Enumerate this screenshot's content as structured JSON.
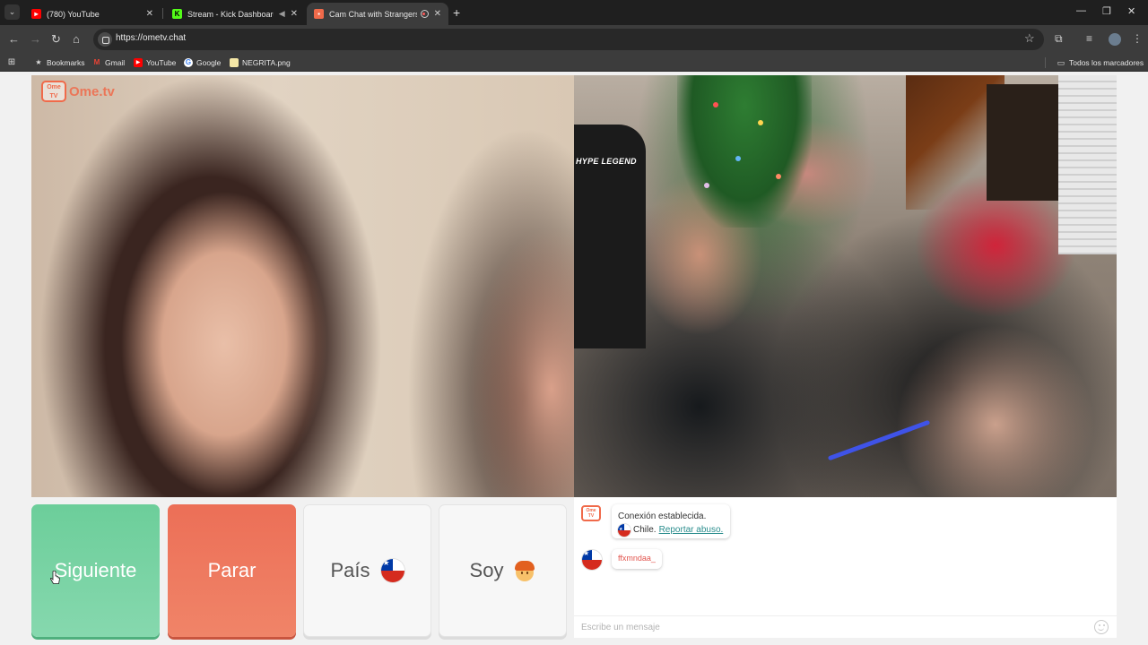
{
  "browser": {
    "tabs": [
      {
        "title": "(780) YouTube",
        "favicon_color": "#ff0000",
        "active": false
      },
      {
        "title": "Stream - Kick Dashboard",
        "favicon_color": "#53fc18",
        "active": false
      },
      {
        "title": "Cam Chat with Strangers on",
        "favicon_color": "#f06a4a",
        "active": true
      }
    ],
    "url": "https://ometv.chat",
    "bookmarks": [
      {
        "label": "Bookmarks",
        "icon": "star-icon"
      },
      {
        "label": "Gmail",
        "icon": "gmail-icon"
      },
      {
        "label": "YouTube",
        "icon": "youtube-icon"
      },
      {
        "label": "Google",
        "icon": "google-icon"
      },
      {
        "label": "NEGRITA.png",
        "icon": "image-file-icon"
      }
    ],
    "all_bookmarks_label": "Todos los marcadores"
  },
  "site": {
    "logo_badge": "Ome TV",
    "logo_text": "Ome.tv",
    "accent": "#f06a4a"
  },
  "video_right": {
    "chair_brand": "HYPE LEGEND"
  },
  "controls": {
    "next_label": "Siguiente",
    "stop_label": "Parar",
    "country_label": "País",
    "country_flag": "chile-flag-icon",
    "gender_label": "Soy",
    "gender_icon": "boy-emoji-icon",
    "next_color": "#6cce9a",
    "stop_color": "#ec6f57"
  },
  "chat": {
    "system_message": "Conexión establecida.",
    "country_name": "Chile.",
    "report_link": "Reportar abuso.",
    "partner_message": "ffxmndaa_",
    "input_placeholder": "Escribe un mensaje"
  }
}
